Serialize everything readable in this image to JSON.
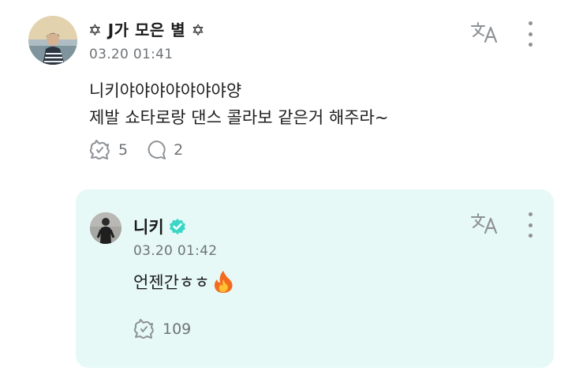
{
  "post": {
    "author": "✡ J가 모은 별 ✡",
    "time": "03.20 01:41",
    "body": "니키야야야야야야야양\n제발 쇼타로랑 댄스 콜라보 같은거 해주라~",
    "like_count": "5",
    "comment_count": "2"
  },
  "reply": {
    "author": "니키",
    "time": "03.20 01:42",
    "body": "언젠간ㅎㅎ",
    "like_count": "109"
  },
  "icons": {
    "translate": "translate-icon",
    "more": "more-vertical-icon",
    "like": "like-stamp-icon",
    "comment": "comment-bubble-icon",
    "verified": "verified-badge-icon",
    "fire": "fire-emoji"
  },
  "colors": {
    "reply_background": "#e6f9f6",
    "verified": "#3bd6c6",
    "meta_text": "#6f7377"
  }
}
